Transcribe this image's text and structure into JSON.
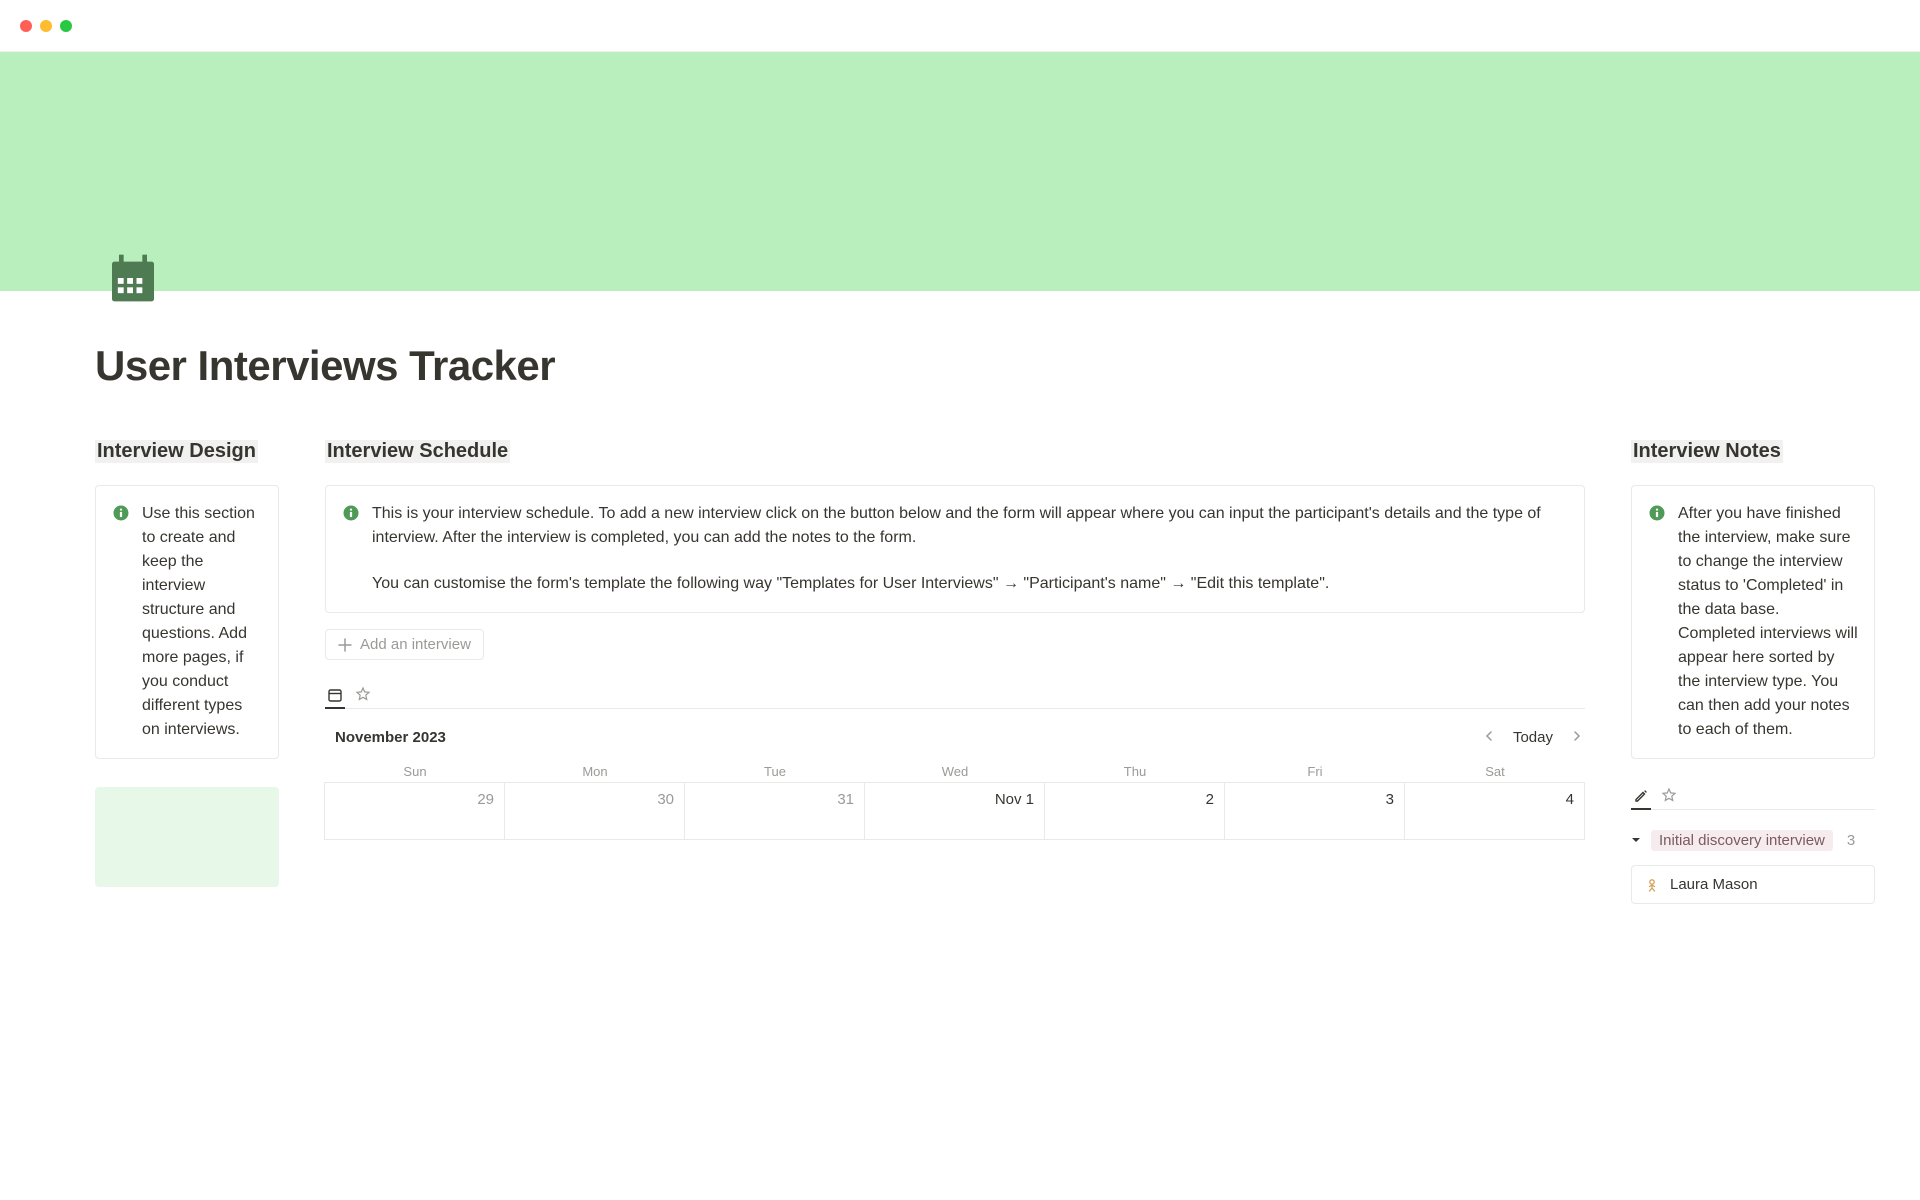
{
  "page": {
    "title": "User Interviews Tracker"
  },
  "design": {
    "heading": "Interview Design",
    "callout": "Use this section to create and keep the interview structure and questions. Add more pages, if you conduct different types on interviews."
  },
  "schedule": {
    "heading": "Interview Schedule",
    "callout_p1": "This is your interview schedule. To add a new interview click on the button below and the form will appear where you can input the participant's details and the type of interview. After the interview is completed, you can add the notes to the form.",
    "callout_p2": "You can customise the form's template the following way \"Templates for User Interviews\" → \"Participant's name\" → \"Edit this template\".",
    "add_label": "Add an interview",
    "calendar": {
      "month": "November 2023",
      "today_label": "Today",
      "dow": [
        "Sun",
        "Mon",
        "Tue",
        "Wed",
        "Thu",
        "Fri",
        "Sat"
      ],
      "row1": [
        "29",
        "30",
        "31",
        "Nov 1",
        "2",
        "3",
        "4"
      ]
    }
  },
  "notes": {
    "heading": "Interview Notes",
    "callout": "After you have finished the interview, make sure to change the interview status to 'Completed' in the data base. Completed interviews will appear here sorted by the interview type. You can then add your notes to each of them.",
    "group_tag": "Initial discovery interview",
    "group_count": "3",
    "person": "Laura Mason"
  }
}
